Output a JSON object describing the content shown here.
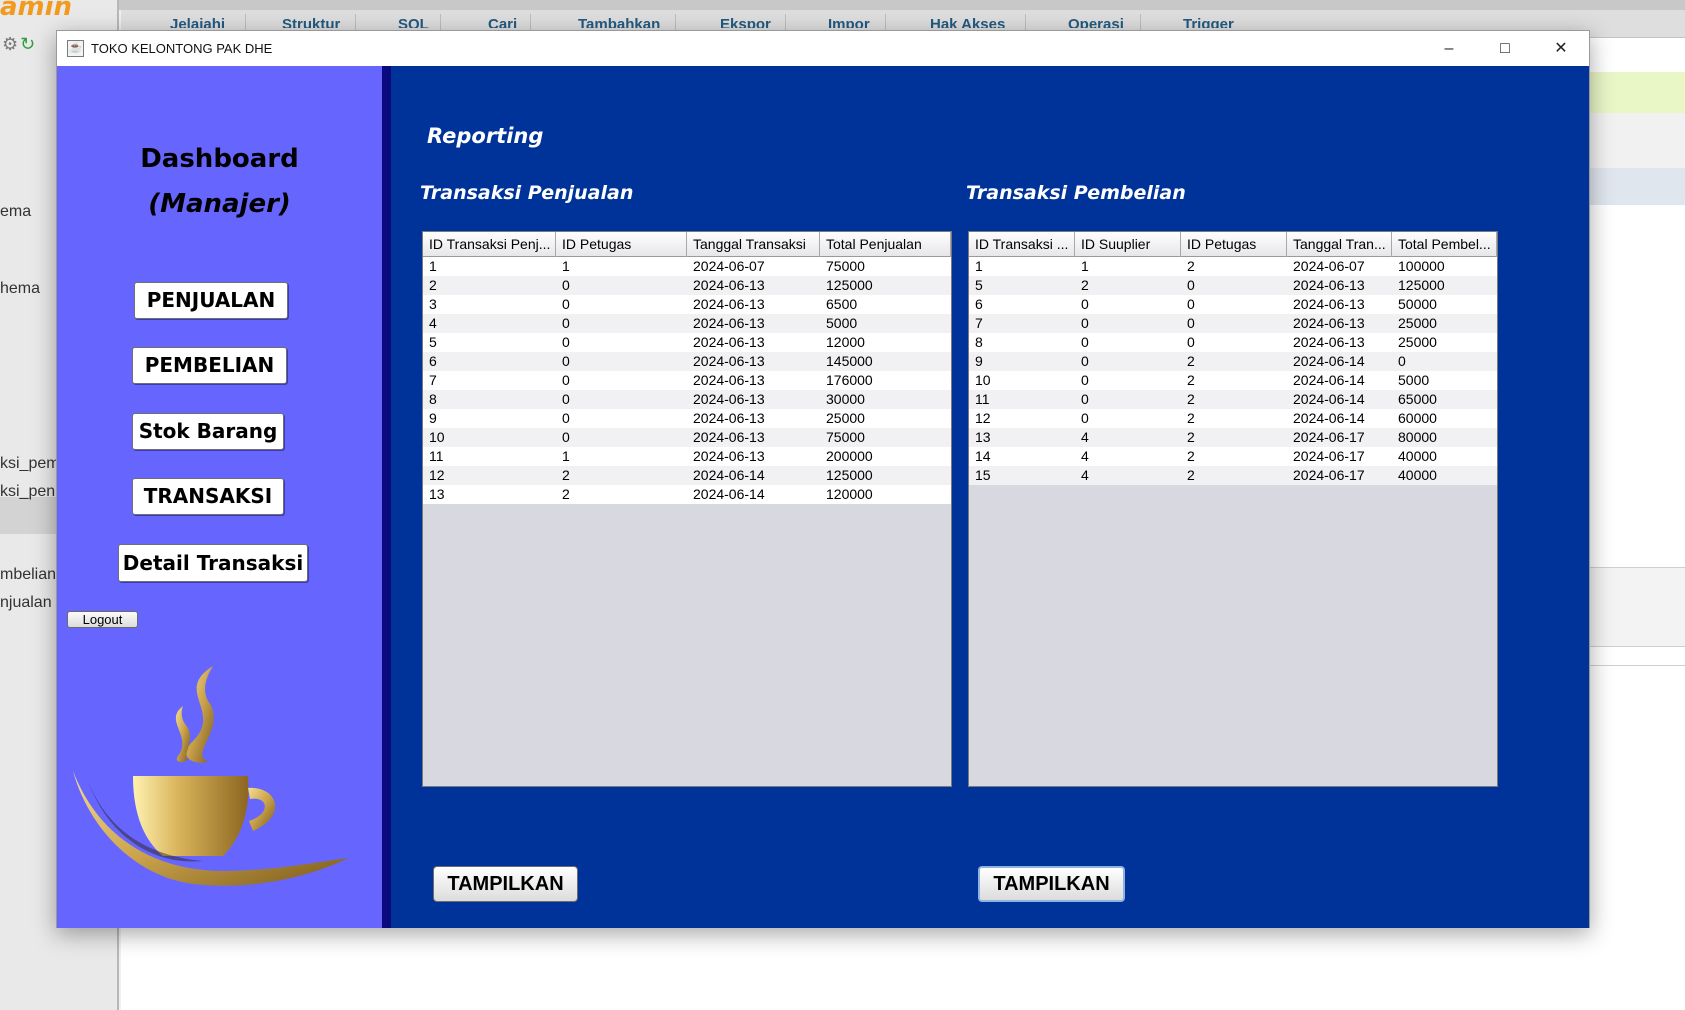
{
  "background": {
    "logo_text": "amin",
    "tabs": [
      "Jelajahi",
      "Struktur",
      "SQL",
      "Cari",
      "Tambahkan",
      "Ekspor",
      "Impor",
      "Hak Akses",
      "Operasi",
      "Trigger"
    ],
    "nav_items": [
      "ema",
      "hema",
      "ksi_pem",
      "ksi_pen",
      "mbelian",
      "njualan"
    ],
    "tools_icons": [
      "gear-icon",
      "reload-icon"
    ]
  },
  "window": {
    "title": "TOKO KELONTONG PAK DHE",
    "controls": {
      "minimize": "–",
      "maximize": "□",
      "close": "✕"
    }
  },
  "sidebar": {
    "title": "Dashboard",
    "subtitle": "(Manajer)",
    "buttons": {
      "penjualan": "PENJUALAN",
      "pembelian": "PEMBELIAN",
      "stok": "Stok Barang",
      "transaksi": "TRANSAKSI",
      "detail": "Detail Transaksi"
    },
    "logout": "Logout"
  },
  "main": {
    "heading": "Reporting",
    "penjualan": {
      "title": "Transaksi Penjualan",
      "columns": [
        "ID Transaksi Penj...",
        "ID Petugas",
        "Tanggal Transaksi",
        "Total Penjualan"
      ],
      "rows": [
        [
          "1",
          "1",
          "2024-06-07",
          "75000"
        ],
        [
          "2",
          "0",
          "2024-06-13",
          "125000"
        ],
        [
          "3",
          "0",
          "2024-06-13",
          "6500"
        ],
        [
          "4",
          "0",
          "2024-06-13",
          "5000"
        ],
        [
          "5",
          "0",
          "2024-06-13",
          "12000"
        ],
        [
          "6",
          "0",
          "2024-06-13",
          "145000"
        ],
        [
          "7",
          "0",
          "2024-06-13",
          "176000"
        ],
        [
          "8",
          "0",
          "2024-06-13",
          "30000"
        ],
        [
          "9",
          "0",
          "2024-06-13",
          "25000"
        ],
        [
          "10",
          "0",
          "2024-06-13",
          "75000"
        ],
        [
          "11",
          "1",
          "2024-06-13",
          "200000"
        ],
        [
          "12",
          "2",
          "2024-06-14",
          "125000"
        ],
        [
          "13",
          "2",
          "2024-06-14",
          "120000"
        ]
      ],
      "button": "TAMPILKAN"
    },
    "pembelian": {
      "title": "Transaksi Pembelian",
      "columns": [
        "ID Transaksi ...",
        "ID Suuplier",
        "ID Petugas",
        "Tanggal Tran...",
        "Total Pembel..."
      ],
      "rows": [
        [
          "1",
          "1",
          "2",
          "2024-06-07",
          "100000"
        ],
        [
          "5",
          "2",
          "0",
          "2024-06-13",
          "125000"
        ],
        [
          "6",
          "0",
          "0",
          "2024-06-13",
          "50000"
        ],
        [
          "7",
          "0",
          "0",
          "2024-06-13",
          "25000"
        ],
        [
          "8",
          "0",
          "0",
          "2024-06-13",
          "25000"
        ],
        [
          "9",
          "0",
          "2",
          "2024-06-14",
          "0"
        ],
        [
          "10",
          "0",
          "2",
          "2024-06-14",
          "5000"
        ],
        [
          "11",
          "0",
          "2",
          "2024-06-14",
          "65000"
        ],
        [
          "12",
          "0",
          "2",
          "2024-06-14",
          "60000"
        ],
        [
          "13",
          "4",
          "2",
          "2024-06-17",
          "80000"
        ],
        [
          "14",
          "4",
          "2",
          "2024-06-17",
          "40000"
        ],
        [
          "15",
          "4",
          "2",
          "2024-06-17",
          "40000"
        ]
      ],
      "button": "TAMPILKAN"
    }
  },
  "colors": {
    "sidebar": "#6666ff",
    "content": "#003399",
    "divider": "#0a0a7c",
    "logo_gold": "#c9a24a"
  }
}
